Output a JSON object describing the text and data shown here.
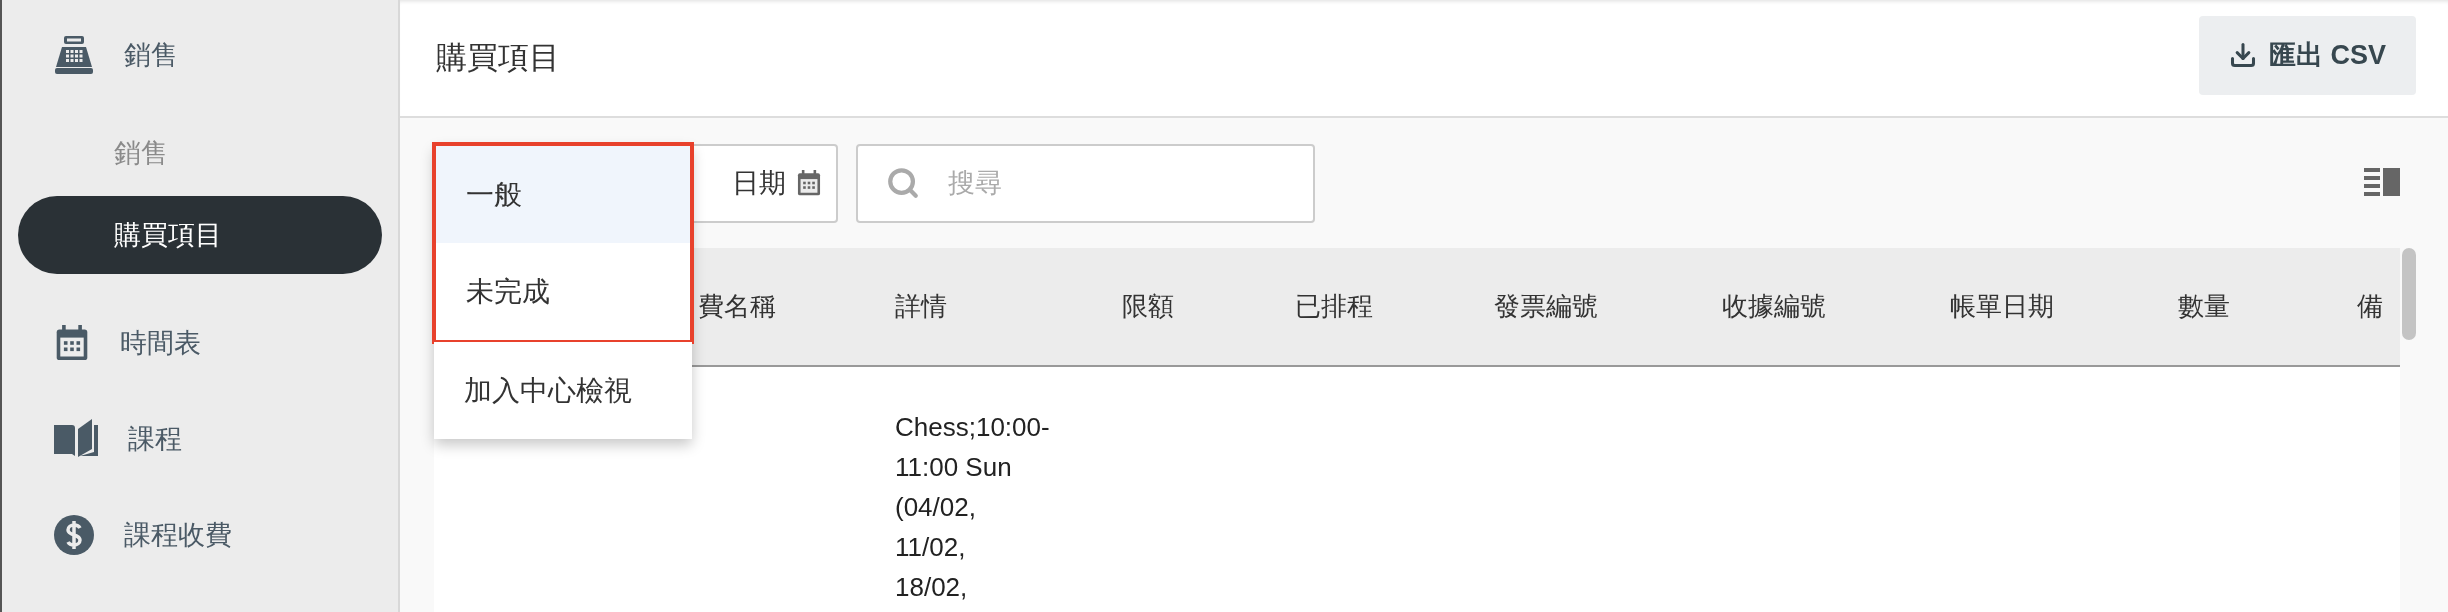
{
  "sidebar": {
    "items": [
      {
        "label": "銷售",
        "selected": false,
        "children": [
          {
            "label": "銷售",
            "selected": false
          },
          {
            "label": "購買項目",
            "selected": true
          }
        ]
      },
      {
        "label": "時間表",
        "selected": false
      },
      {
        "label": "課程",
        "selected": false
      },
      {
        "label": "課程收費",
        "selected": false
      }
    ]
  },
  "header": {
    "title": "購買項目",
    "export_button": "匯出 CSV"
  },
  "toolbar": {
    "date_button": "日期",
    "search": {
      "placeholder": "搜尋"
    }
  },
  "menu": {
    "items": [
      {
        "label": "一般",
        "selected": true,
        "highlighted": true
      },
      {
        "label": "未完成",
        "selected": false,
        "highlighted": true
      },
      {
        "label": "加入中心檢視",
        "selected": false,
        "highlighted": false
      }
    ]
  },
  "table": {
    "columns": [
      "費名稱",
      "詳情",
      "限額",
      "已排程",
      "發票編號",
      "收據編號",
      "帳單日期",
      "數量",
      "備"
    ],
    "rows": [
      {
        "details": "Chess;10:00-\n11:00 Sun\n(04/02,\n11/02,\n18/02,"
      }
    ]
  }
}
